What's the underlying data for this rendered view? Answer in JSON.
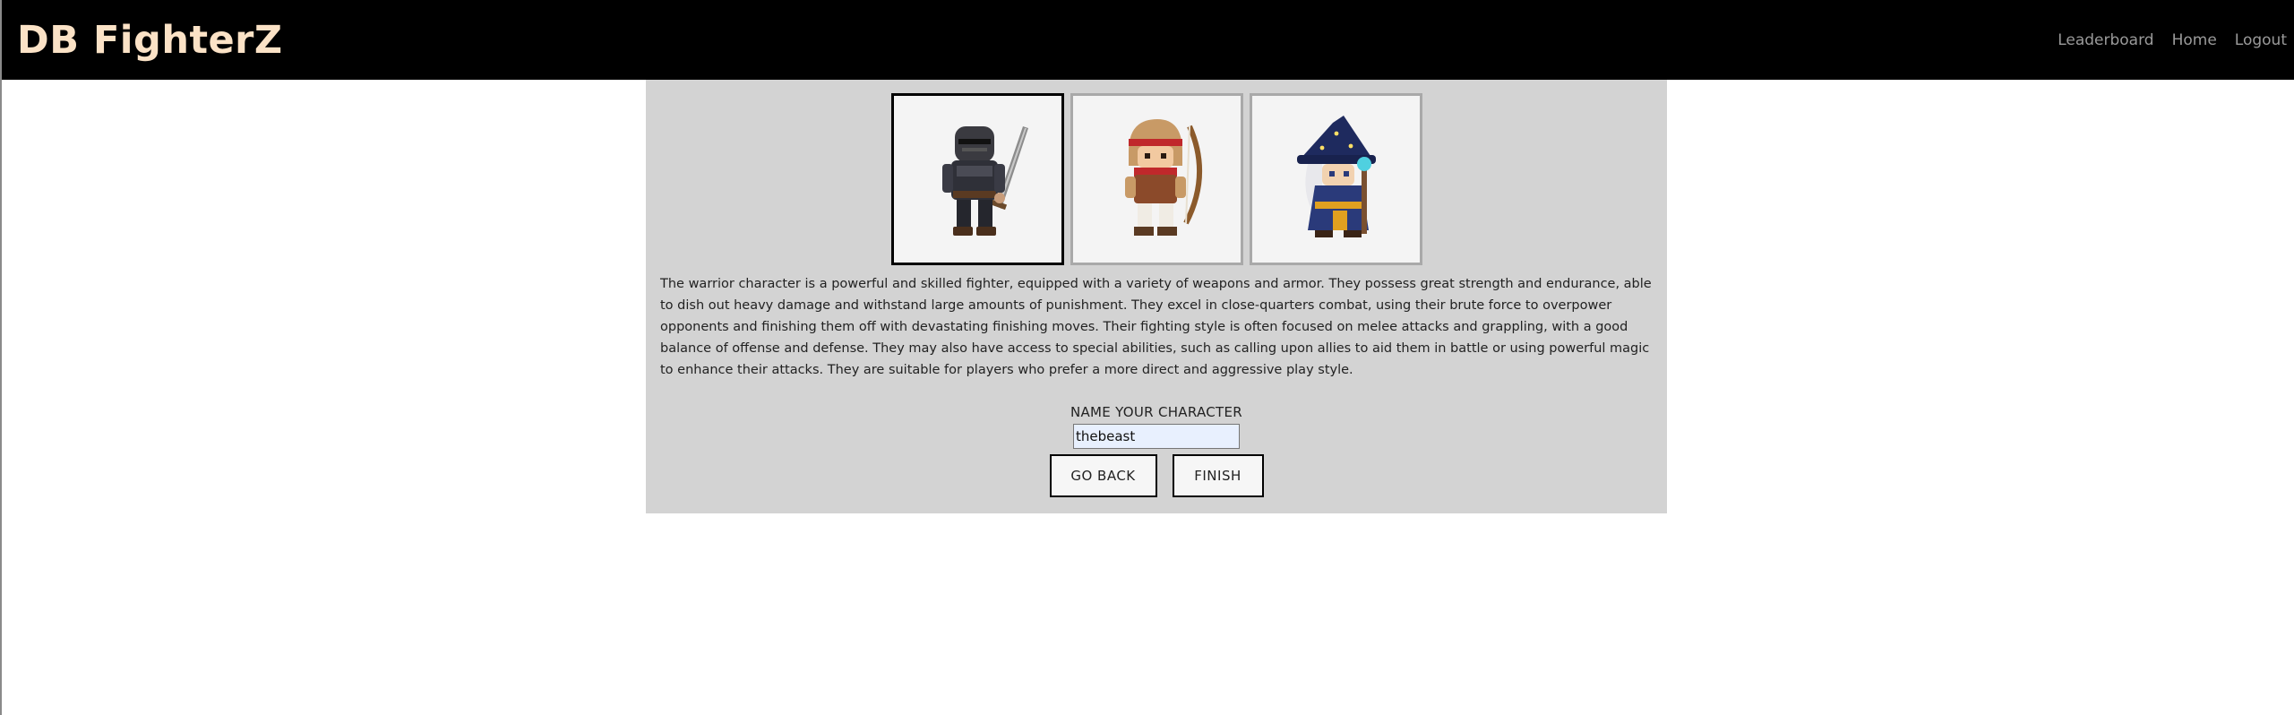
{
  "navbar": {
    "brand": "DB FighterZ",
    "links": [
      "Leaderboard",
      "Home",
      "Logout"
    ]
  },
  "characters": [
    {
      "icon": "warrior-sprite-icon",
      "selected": true
    },
    {
      "icon": "archer-sprite-icon",
      "selected": false
    },
    {
      "icon": "wizard-sprite-icon",
      "selected": false
    }
  ],
  "description": "The warrior character is a powerful and skilled fighter, equipped with a variety of weapons and armor. They possess great strength and endurance, able to dish out heavy damage and withstand large amounts of punishment. They excel in close-quarters combat, using their brute force to overpower opponents and finishing them off with devastating finishing moves. Their fighting style is often focused on melee attacks and grappling, with a good balance of offense and defense. They may also have access to special abilities, such as calling upon allies to aid them in battle or using powerful magic to enhance their attacks. They are suitable for players who prefer a more direct and aggressive play style.",
  "form": {
    "label": "NAME YOUR CHARACTER",
    "name_value": "thebeast",
    "back_label": "GO BACK",
    "finish_label": "FINISH"
  },
  "colors": {
    "navbar_bg": "#000000",
    "brand": "#fbe2c6",
    "nav_link": "#9a9a9a",
    "panel_bg": "#d3d3d3",
    "input_bg": "#e8f0fe"
  }
}
